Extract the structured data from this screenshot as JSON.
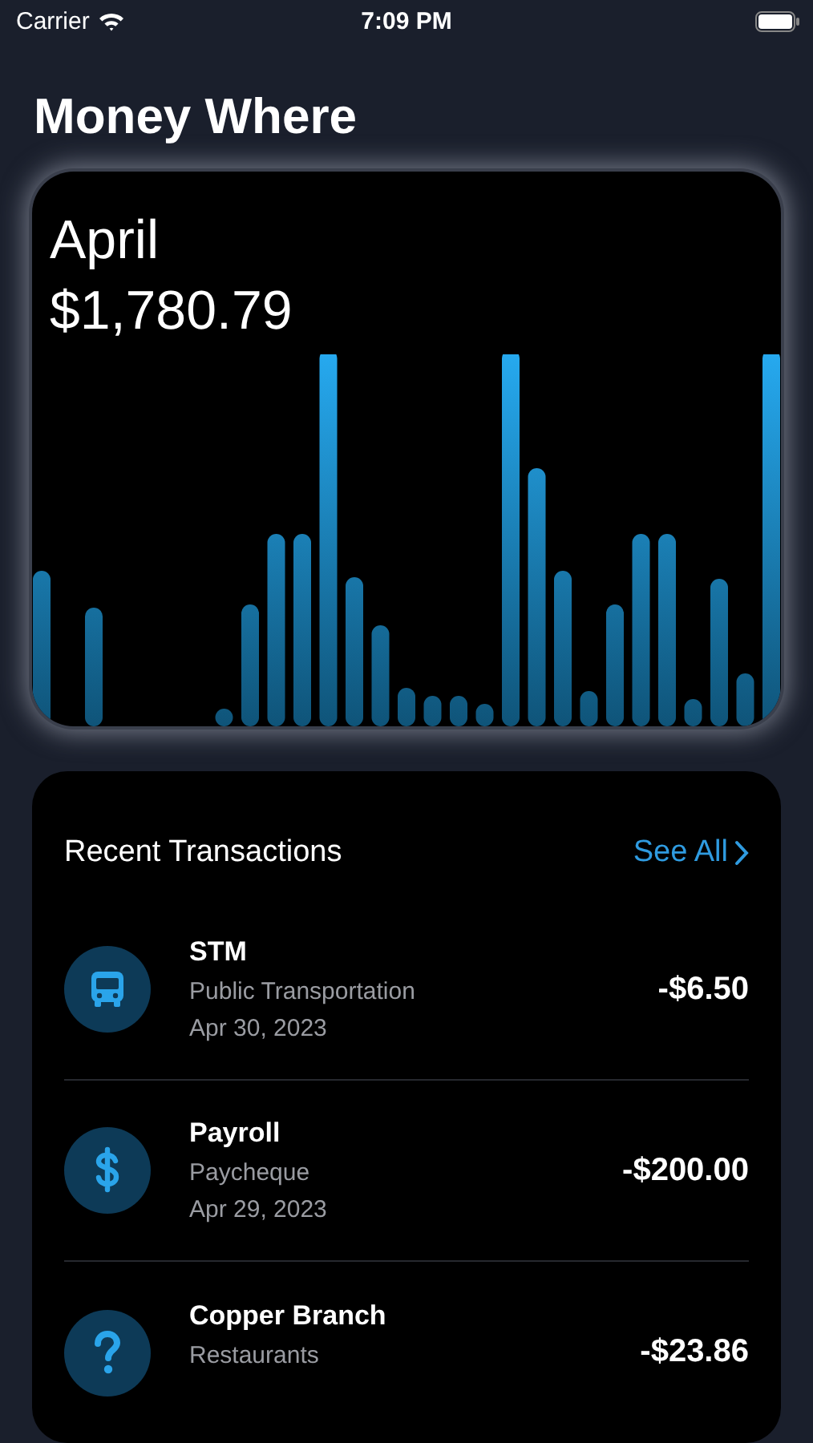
{
  "status_bar": {
    "carrier": "Carrier",
    "time": "7:09 PM"
  },
  "title": "Money Where",
  "summary": {
    "month": "April",
    "total": "$1,780.79"
  },
  "transactions": {
    "title": "Recent Transactions",
    "see_all": "See All",
    "items": [
      {
        "kind": "bus",
        "name": "STM",
        "category": "Public Transportation",
        "date": "Apr 30, 2023",
        "amount": "-$6.50"
      },
      {
        "kind": "dollar",
        "name": "Payroll",
        "category": "Paycheque",
        "date": "Apr 29, 2023",
        "amount": "-$200.00"
      },
      {
        "kind": "unknown",
        "name": "Copper Branch",
        "category": "Restaurants",
        "amount": "-$23.86"
      }
    ]
  }
}
